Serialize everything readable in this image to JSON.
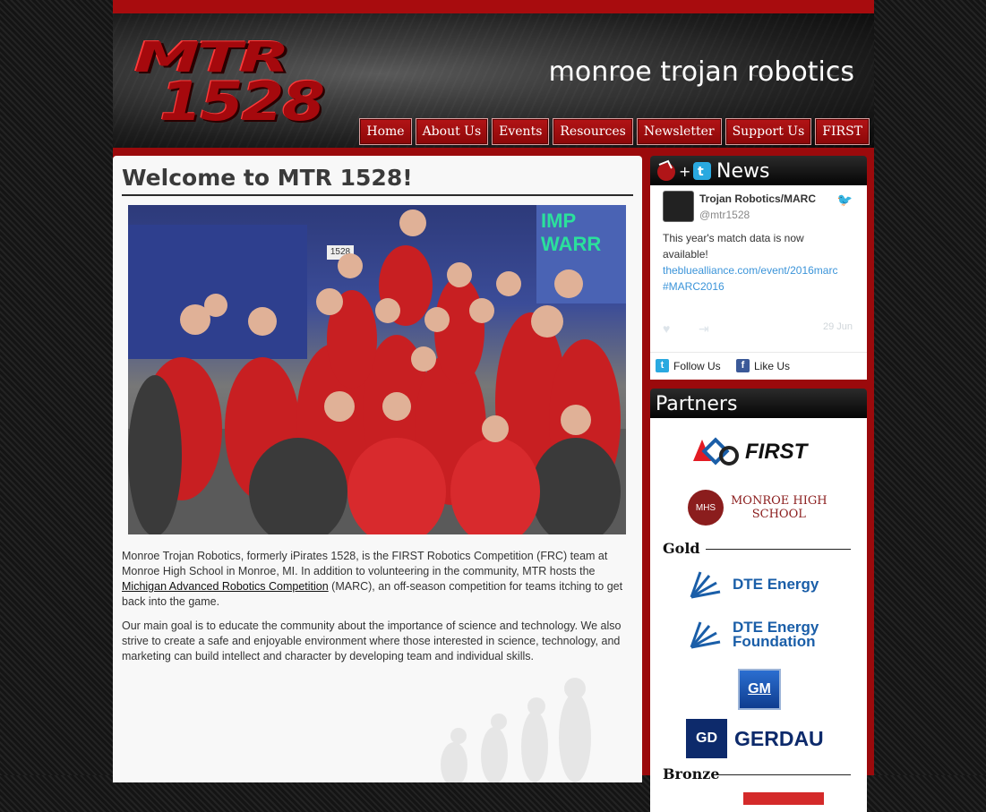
{
  "header": {
    "logo_line1": "MTR",
    "logo_line2": "1528",
    "site_title": "monroe trojan robotics"
  },
  "nav": [
    {
      "label": "Home"
    },
    {
      "label": "About Us"
    },
    {
      "label": "Events"
    },
    {
      "label": "Resources"
    },
    {
      "label": "Newsletter"
    },
    {
      "label": "Support Us"
    },
    {
      "label": "FIRST"
    }
  ],
  "main": {
    "heading": "Welcome to MTR 1528!",
    "photo_sign": "1528",
    "photo_banner": "IMP WARR",
    "para1_before": "Monroe Trojan Robotics, formerly iPirates 1528, is the FIRST Robotics Competition (FRC) team at Monroe High School in Monroe, MI. In addition to volunteering in the community, MTR hosts the ",
    "para1_link": "Michigan Advanced Robotics Competition",
    "para1_after": " (MARC), an off-season competition for teams itching to get back into the game.",
    "para2": "Our main goal is to educate the community about the importance of science and technology. We also strive to create a safe and enjoyable environment where those interested in science, technology, and marketing can build intellect and character by developing team and individual skills."
  },
  "news": {
    "title": "News",
    "tweet": {
      "name": "Trojan Robotics/MARC",
      "handle": "@mtr1528",
      "text_before": "This year's match data is now available! ",
      "link": "thebluealliance.com/event/2016marc",
      "hashtag": "#MARC2016",
      "date": "29 Jun"
    },
    "follow_label": "Follow Us",
    "like_label": "Like Us"
  },
  "partners": {
    "title": "Partners",
    "logos": {
      "first": "FIRST",
      "monroe_line1": "MONROE HIGH",
      "monroe_line2": "SCHOOL",
      "monroe_seal": "MHS",
      "dte": "DTE Energy",
      "dte_foundation_line1": "DTE Energy",
      "dte_foundation_line2": "Foundation",
      "gm": "GM",
      "gerdau_mark": "GD",
      "gerdau": "GERDAU"
    },
    "tiers": {
      "gold": "Gold",
      "bronze": "Bronze"
    }
  },
  "colors": {
    "brand_red": "#9b0a0c",
    "header_dark": "#1e1e1e",
    "link_blue": "#3b94d9",
    "dte_blue": "#1a5ea8",
    "gerdau_navy": "#0d2a6b"
  }
}
